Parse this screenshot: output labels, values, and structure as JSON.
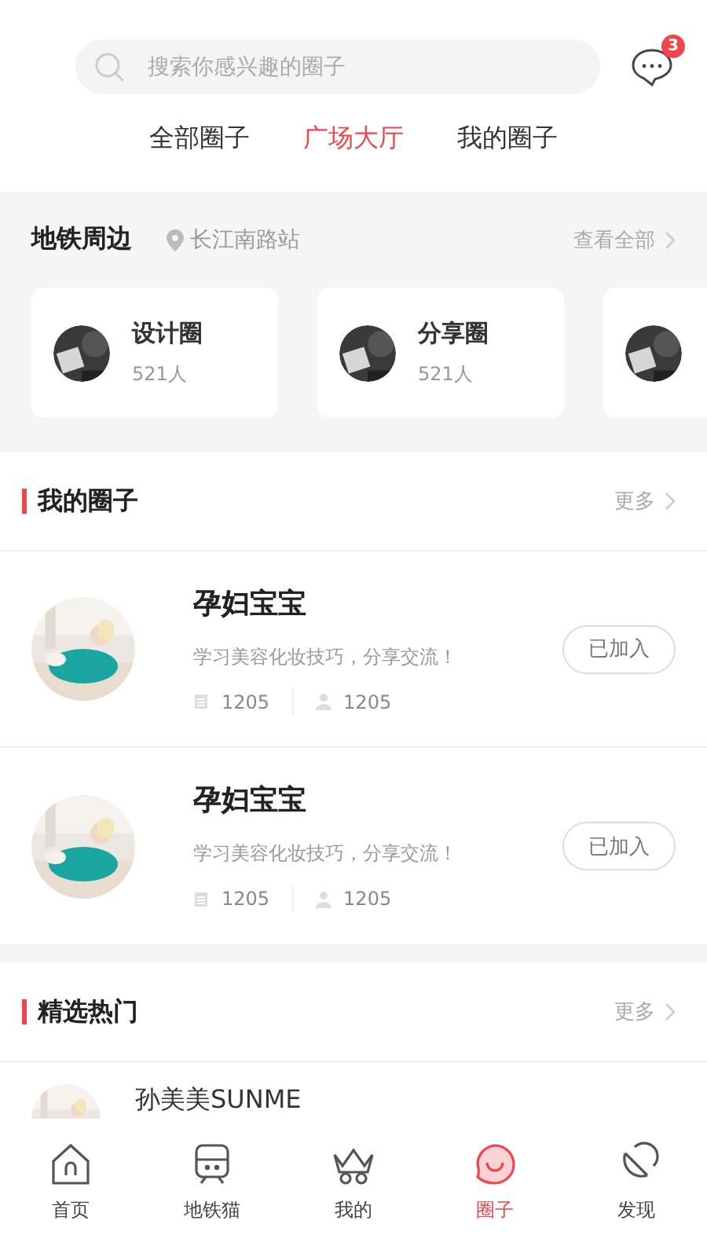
{
  "search": {
    "placeholder": "搜索你感兴趣的圈子"
  },
  "messages_badge": "3",
  "tabs": [
    {
      "label": "全部圈子",
      "selected": false
    },
    {
      "label": "广场大厅",
      "selected": true
    },
    {
      "label": "我的圈子",
      "selected": false
    }
  ],
  "nearby": {
    "title": "地铁周边",
    "station": "长江南路站",
    "more": "查看全部",
    "circles": [
      {
        "kind": "card",
        "name": "设计圈",
        "count": "521人"
      },
      {
        "kind": "card",
        "name": "分享圈",
        "count": "521人"
      },
      {
        "kind": "picture"
      }
    ]
  },
  "my_circles": {
    "title": "我的圈子",
    "more": "更多",
    "items": [
      {
        "name": "孕妇宝宝",
        "description": "学习美容化妆技巧，分享交流！",
        "posts": "1205",
        "members": "1205",
        "action": "已加入"
      },
      {
        "name": "孕妇宝宝",
        "description": "学习美容化妆技巧，分享交流！",
        "posts": "1205",
        "members": "1205",
        "action": "已加入"
      }
    ]
  },
  "hot": {
    "title": "精选热门",
    "more": "更多",
    "items": [
      {
        "name": "孙美美SUNME"
      }
    ]
  },
  "bottom_nav": [
    {
      "label": "首页",
      "kind": "home",
      "selected": false
    },
    {
      "label": "地铁猫",
      "kind": "train",
      "selected": false
    },
    {
      "label": "我的",
      "kind": "crown",
      "selected": false
    },
    {
      "label": "圈子",
      "kind": "chat",
      "selected": true
    },
    {
      "label": "发现",
      "kind": "dish",
      "selected": false
    }
  ]
}
